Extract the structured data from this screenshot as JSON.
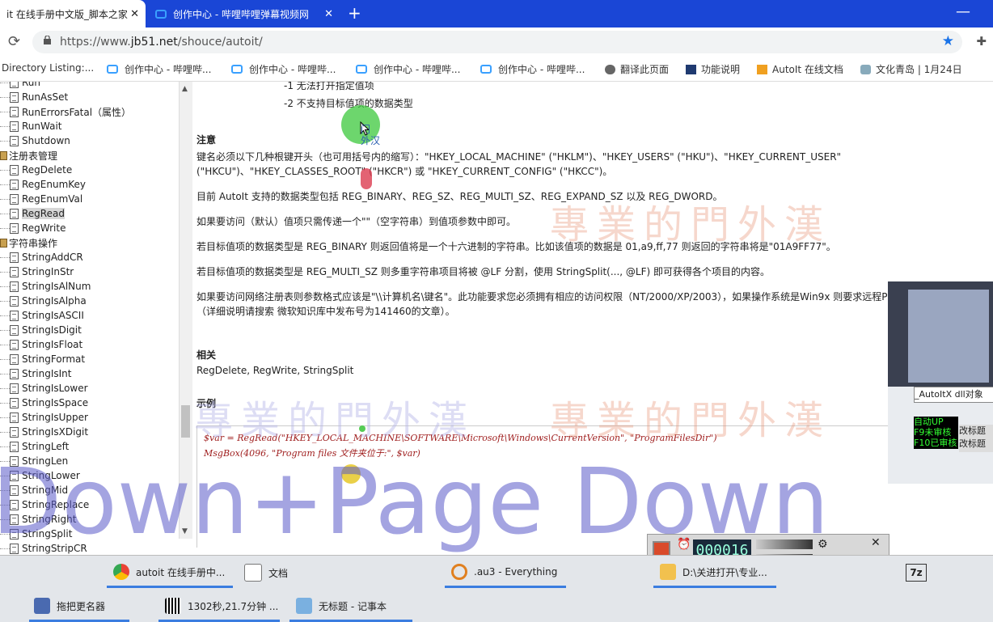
{
  "browser": {
    "tabs": [
      {
        "label": "it 在线手册中文版_脚本之家",
        "active": true,
        "close": "✕"
      },
      {
        "label": "创作中心 - 哔哩哔哩弹幕视频网",
        "active": false,
        "close": "✕"
      }
    ],
    "new_tab": "+",
    "minimize": "—",
    "url_prefix": "https://www.",
    "url_host": "jb51.net",
    "url_path": "/shouce/autoit/"
  },
  "bookmarks": [
    {
      "label": "Directory Listing:..."
    },
    {
      "label": "创作中心 - 哔哩哔..."
    },
    {
      "label": "创作中心 - 哔哩哔..."
    },
    {
      "label": "创作中心 - 哔哩哔..."
    },
    {
      "label": "创作中心 - 哔哩哔..."
    },
    {
      "label": "翻译此页面"
    },
    {
      "label": "功能说明"
    },
    {
      "label": "AutoIt 在线文档"
    },
    {
      "label": "文化青岛 | 1月24日"
    }
  ],
  "sidebar": {
    "items": [
      {
        "label": "Run",
        "type": "doc"
      },
      {
        "label": "RunAsSet",
        "type": "doc"
      },
      {
        "label": "RunErrorsFatal（属性）",
        "type": "doc"
      },
      {
        "label": "RunWait",
        "type": "doc"
      },
      {
        "label": "Shutdown",
        "type": "doc"
      },
      {
        "label": "注册表管理",
        "type": "folder"
      },
      {
        "label": "RegDelete",
        "type": "doc"
      },
      {
        "label": "RegEnumKey",
        "type": "doc"
      },
      {
        "label": "RegEnumVal",
        "type": "doc"
      },
      {
        "label": "RegRead",
        "type": "doc",
        "selected": true
      },
      {
        "label": "RegWrite",
        "type": "doc"
      },
      {
        "label": "字符串操作",
        "type": "folder"
      },
      {
        "label": "StringAddCR",
        "type": "doc"
      },
      {
        "label": "StringInStr",
        "type": "doc"
      },
      {
        "label": "StringIsAlNum",
        "type": "doc"
      },
      {
        "label": "StringIsAlpha",
        "type": "doc"
      },
      {
        "label": "StringIsASCII",
        "type": "doc"
      },
      {
        "label": "StringIsDigit",
        "type": "doc"
      },
      {
        "label": "StringIsFloat",
        "type": "doc"
      },
      {
        "label": "StringFormat",
        "type": "doc"
      },
      {
        "label": "StringIsInt",
        "type": "doc"
      },
      {
        "label": "StringIsLower",
        "type": "doc"
      },
      {
        "label": "StringIsSpace",
        "type": "doc"
      },
      {
        "label": "StringIsUpper",
        "type": "doc"
      },
      {
        "label": "StringIsXDigit",
        "type": "doc"
      },
      {
        "label": "StringLeft",
        "type": "doc"
      },
      {
        "label": "StringLen",
        "type": "doc"
      },
      {
        "label": "StringLower",
        "type": "doc"
      },
      {
        "label": "StringMid",
        "type": "doc"
      },
      {
        "label": "StringReplace",
        "type": "doc"
      },
      {
        "label": "StringRight",
        "type": "doc"
      },
      {
        "label": "StringSplit",
        "type": "doc"
      },
      {
        "label": "StringStripCR",
        "type": "doc"
      }
    ]
  },
  "content": {
    "ret1": "-1 无法打开指定值项",
    "ret2": "-2 不支持目标值项的数据类型",
    "note_heading": "注意",
    "note1a": "键名必须以下几种根键开头（也可用括号内的缩写）：\"HKEY_LOCAL_MACHINE\" (\"HKLM\")、\"HKEY_USERS\" (\"HKU\")、\"HKEY_CURRENT_USER\"",
    "note1b": "(\"HKCU\")、\"HKEY_CLASSES_ROOT\" (\"HKCR\") 或 \"HKEY_CURRENT_CONFIG\" (\"HKCC\")。",
    "note2": "目前 AutoIt 支持的数据类型包括 REG_BINARY、REG_SZ、REG_MULTI_SZ、REG_EXPAND_SZ 以及 REG_DWORD。",
    "note3": "如果要访问（默认）值项只需传递一个\"\"（空字符串）到值项参数中即可。",
    "note4": "若目标值项的数据类型是 REG_BINARY 则返回值将是一个十六进制的字符串。比如该值项的数据是 01,a9,ff,77 则返回的字符串将是\"01A9FF77\"。",
    "note5": "若目标值项的数据类型是 REG_MULTI_SZ 则多重字符串项目将被 @LF 分割，使用 StringSplit(..., @LF) 即可获得各个项目的内容。",
    "note6a": "如果要访问网络注册表则参数格式应该是\"\\\\计算机名\\键名\"。此功能要求您必须拥有相应的访问权限（NT/2000/XP/2003），如果操作系统是Win9x 则要求远程PC必须先安装远程注册",
    "note6b": "（详细说明请搜索 微软知识库中发布号为141460的文章）。",
    "related_heading": "相关",
    "related_links": "RegDelete, RegWrite, StringSplit",
    "example_heading": "示例",
    "code1": "$var = RegRead(\"HKEY_LOCAL_MACHINE\\SOFTWARE\\Microsoft\\Windows\\CurrentVersion\", \"ProgramFilesDir\")",
    "code2": "MsgBox(4096, \"Program files 文件夹位于:\", $var)"
  },
  "overlay": {
    "cursor_text1": "门",
    "cursor_text2": "外汉",
    "watermark": "專業的門外漢",
    "keys_banner": "Down+Page Down",
    "autoitx_label": "_AutoItX dll对象",
    "green_label1": "自动UP",
    "green_label2": "F9未审核",
    "green_label3": "F10已审核",
    "gai1": "改标题",
    "gai2": "改标题",
    "timer": "000016"
  },
  "taskbar": {
    "row1": [
      {
        "label": "autoit 在线手册中..."
      },
      {
        "label": "文档"
      },
      {
        "label": ".au3 - Everything"
      },
      {
        "label": "D:\\关进打开\\专业..."
      }
    ],
    "row2": [
      {
        "label": "拖把更名器"
      },
      {
        "label": "1302秒,21.7分钟 ..."
      },
      {
        "label": "无标题 - 记事本"
      }
    ],
    "badge_7z": "7z"
  }
}
